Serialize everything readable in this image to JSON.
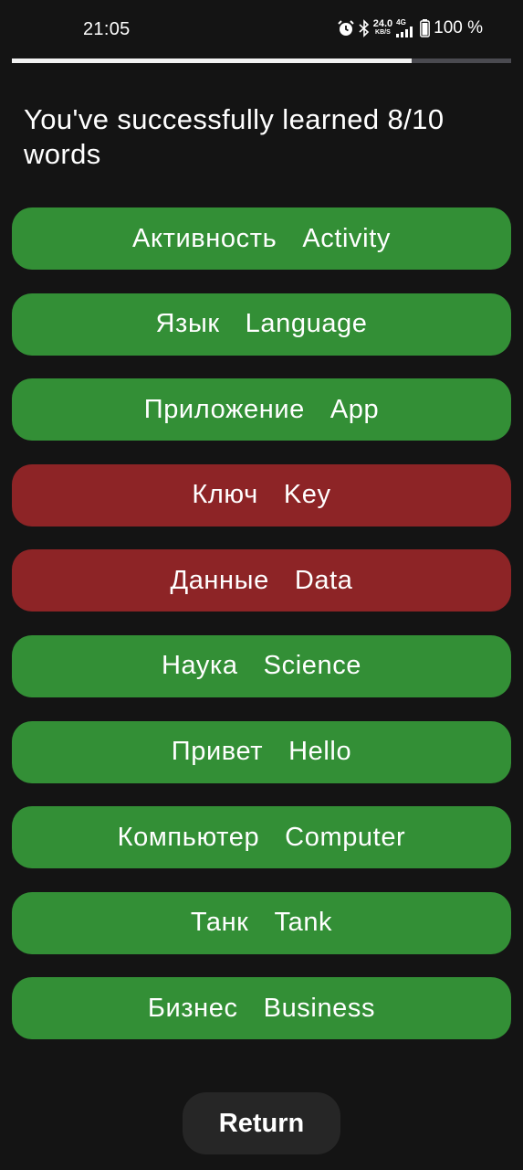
{
  "status_bar": {
    "time": "21:05",
    "speed_value": "24.0",
    "speed_unit": "KB/S",
    "network": "4G",
    "battery": "100 %"
  },
  "progress": {
    "fraction": 0.8,
    "track_color": "#4a4a50",
    "fill_color": "#f2f2f2"
  },
  "result_text": "You've successfully learned 8/10 words",
  "words": [
    {
      "ru": "Активность",
      "en": "Activity",
      "learned": true
    },
    {
      "ru": "Язык",
      "en": "Language",
      "learned": true
    },
    {
      "ru": "Приложение",
      "en": "App",
      "learned": true
    },
    {
      "ru": "Ключ",
      "en": "Key",
      "learned": false
    },
    {
      "ru": "Данные",
      "en": "Data",
      "learned": false
    },
    {
      "ru": "Наука",
      "en": "Science",
      "learned": true
    },
    {
      "ru": "Привет",
      "en": "Hello",
      "learned": true
    },
    {
      "ru": "Компьютер",
      "en": "Computer",
      "learned": true
    },
    {
      "ru": "Танк",
      "en": "Tank",
      "learned": true
    },
    {
      "ru": "Бизнес",
      "en": "Business",
      "learned": true
    }
  ],
  "colors": {
    "learned": "#338f36",
    "missed": "#8d2426",
    "background": "#141414"
  },
  "return_button": {
    "label": "Return"
  }
}
